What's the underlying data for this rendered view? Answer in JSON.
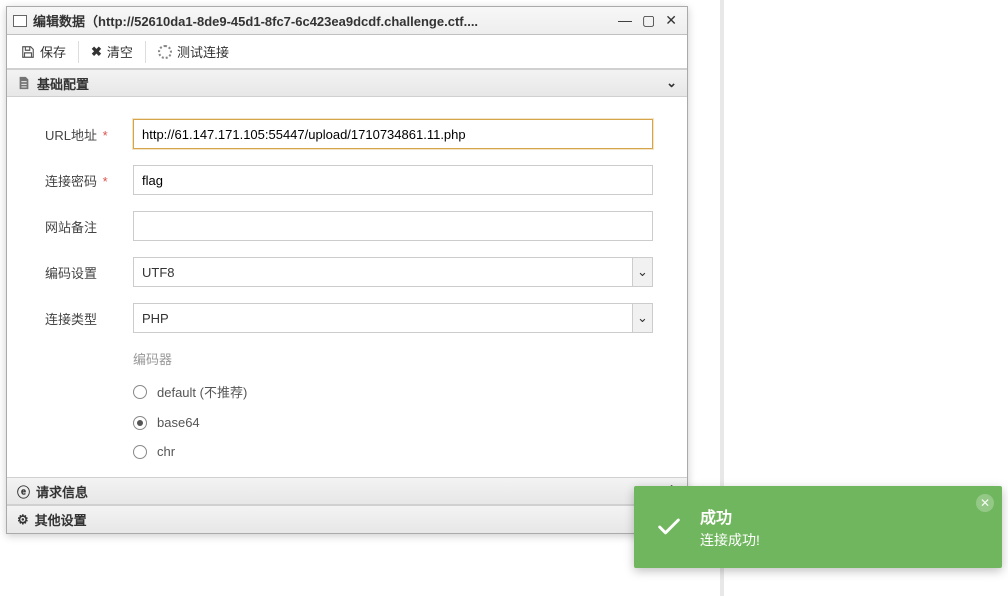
{
  "window": {
    "title": "编辑数据（http://52610da1-8de9-45d1-8fc7-6c423ea9dcdf.challenge.ctf...."
  },
  "toolbar": {
    "save": "保存",
    "clear": "清空",
    "test": "测试连接"
  },
  "sections": {
    "basic": "基础配置",
    "request": "请求信息",
    "other": "其他设置"
  },
  "form": {
    "url_label": "URL地址",
    "url_value": "http://61.147.171.105:55447/upload/1710734861.11.php",
    "pass_label": "连接密码",
    "pass_value": "flag",
    "note_label": "网站备注",
    "note_value": "",
    "encode_label": "编码设置",
    "encode_value": "UTF8",
    "type_label": "连接类型",
    "type_value": "PHP",
    "encoder_heading": "编码器",
    "encoder_options": {
      "default": "default (不推荐)",
      "base64": "base64",
      "chr": "chr"
    },
    "encoder_selected": "base64",
    "required_mark": "*"
  },
  "toast": {
    "title": "成功",
    "body": "连接成功!"
  }
}
